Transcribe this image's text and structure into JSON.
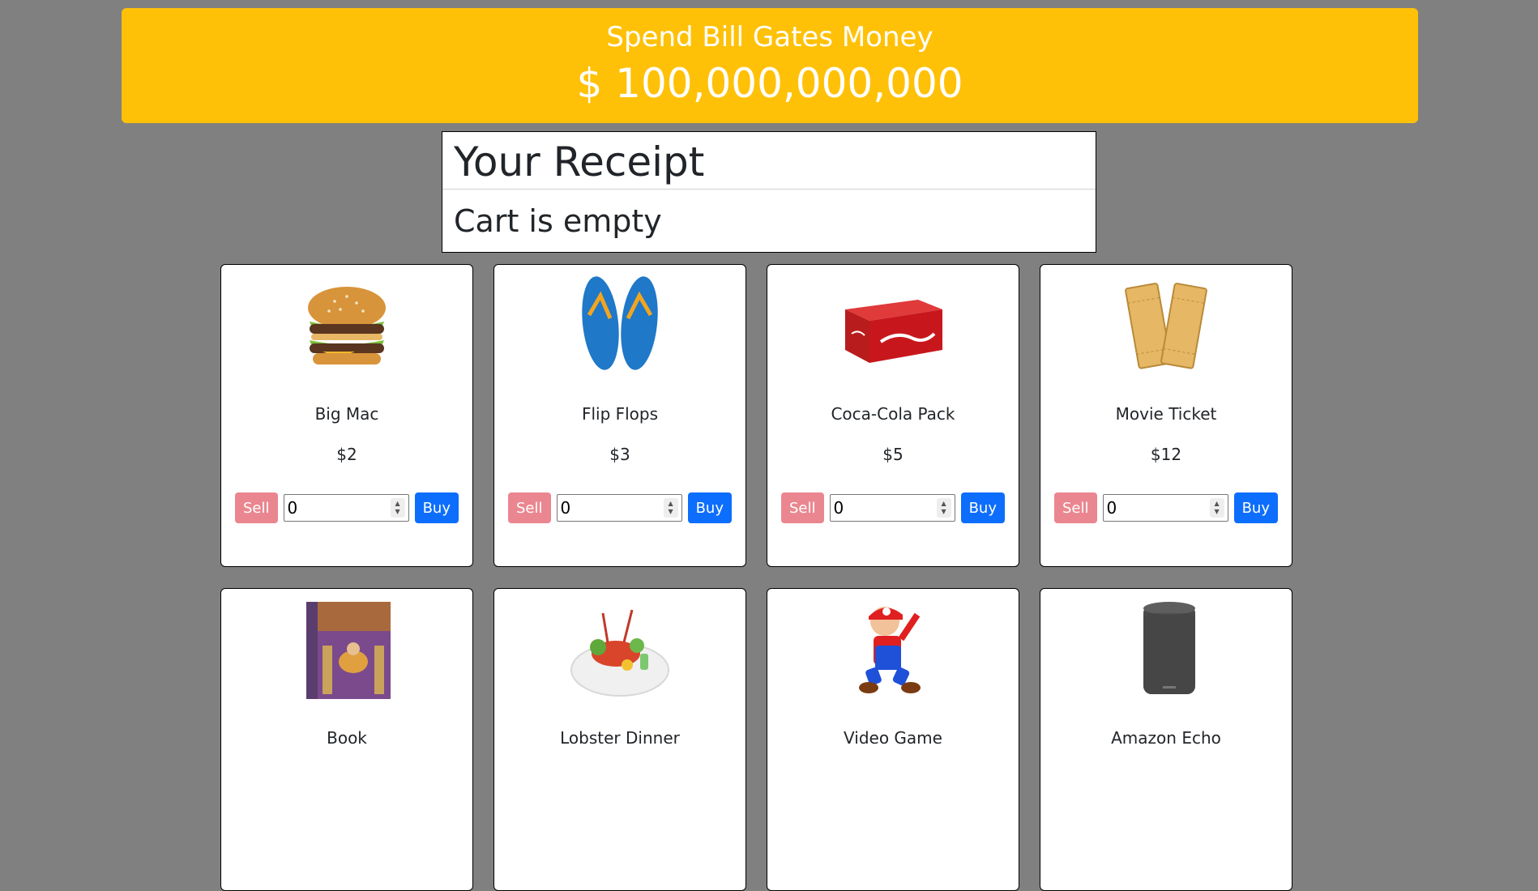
{
  "header": {
    "title": "Spend Bill Gates Money",
    "money": "$ 100,000,000,000",
    "color": "#ffc107"
  },
  "receipt": {
    "title": "Your Receipt",
    "status": "Cart is empty"
  },
  "buttons": {
    "sell_label": "Sell",
    "buy_label": "Buy",
    "sell_color": "#ea868f",
    "buy_color": "#0d6efd"
  },
  "products": [
    {
      "name": "Big Mac",
      "price": "$2",
      "quantity": "0",
      "icon": "burger-image"
    },
    {
      "name": "Flip Flops",
      "price": "$3",
      "quantity": "0",
      "icon": "flip-flops-image"
    },
    {
      "name": "Coca-Cola Pack",
      "price": "$5",
      "quantity": "0",
      "icon": "soda-pack-image"
    },
    {
      "name": "Movie Ticket",
      "price": "$12",
      "quantity": "0",
      "icon": "ticket-image"
    },
    {
      "name": "Book",
      "icon": "book-image"
    },
    {
      "name": "Lobster Dinner",
      "icon": "lobster-dinner-image"
    },
    {
      "name": "Video Game",
      "icon": "video-game-image"
    },
    {
      "name": "Amazon Echo",
      "icon": "smart-speaker-image"
    }
  ]
}
